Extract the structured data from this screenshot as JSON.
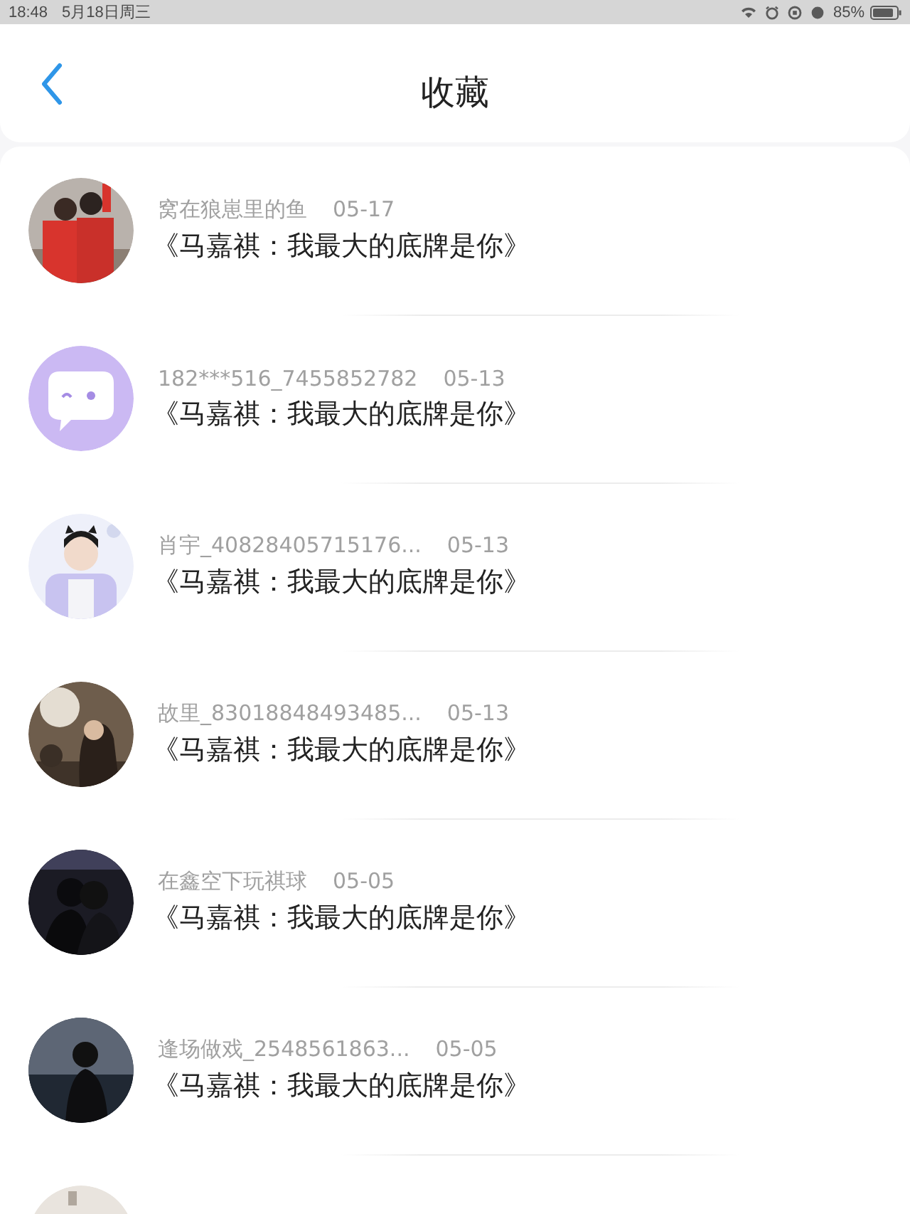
{
  "status_bar": {
    "time": "18:48",
    "date": "5月18日周三",
    "battery": "85%"
  },
  "header": {
    "title": "收藏"
  },
  "items": [
    {
      "avatar": {
        "kind": "picture"
      },
      "name": "窝在狼崽里的鱼",
      "date": "05-17",
      "title": "《马嘉祺：我最大的底牌是你》"
    },
    {
      "avatar": {
        "kind": "icon"
      },
      "name": "182***516_7455852782",
      "date": "05-13",
      "title": "《马嘉祺：我最大的底牌是你》"
    },
    {
      "avatar": {
        "kind": "picture"
      },
      "name": "肖宇_40828405715176...",
      "date": "05-13",
      "title": "《马嘉祺：我最大的底牌是你》"
    },
    {
      "avatar": {
        "kind": "picture"
      },
      "name": "故里_83018848493485...",
      "date": "05-13",
      "title": "《马嘉祺：我最大的底牌是你》"
    },
    {
      "avatar": {
        "kind": "picture"
      },
      "name": "在鑫空下玩祺球",
      "date": "05-05",
      "title": "《马嘉祺：我最大的底牌是你》"
    },
    {
      "avatar": {
        "kind": "picture"
      },
      "name": "逢场做戏_2548561863...",
      "date": "05-05",
      "title": "《马嘉祺：我最大的底牌是你》"
    },
    {
      "avatar": {
        "kind": "picture"
      }
    }
  ]
}
